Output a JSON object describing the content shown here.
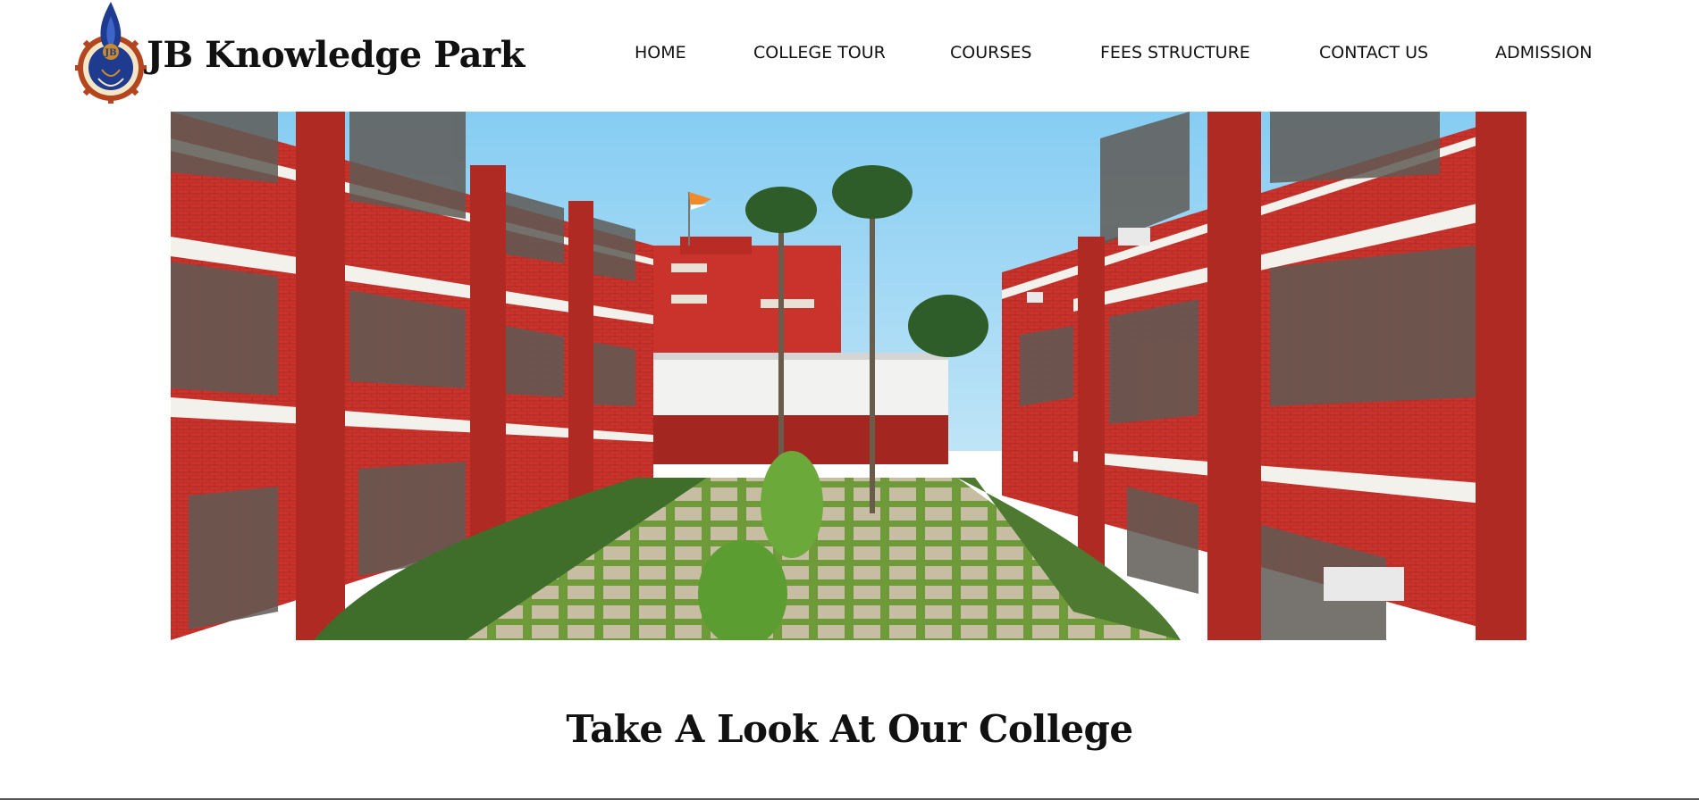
{
  "site": {
    "brand_name": "JB Knowledge Park",
    "logo_icon": "college-crest-icon"
  },
  "nav": {
    "items": [
      {
        "label": "HOME"
      },
      {
        "label": "COLLEGE TOUR"
      },
      {
        "label": "COURSES"
      },
      {
        "label": "FEES STRUCTURE"
      },
      {
        "label": "CONTACT US"
      },
      {
        "label": "ADMISSION"
      }
    ]
  },
  "hero": {
    "image_icon": "campus-courtyard-photo"
  },
  "section": {
    "title": "Take A Look At Our College"
  },
  "colors": {
    "brick": "#c9332c",
    "sky": "#8fd0f2",
    "crest_blue": "#1f3b8f",
    "crest_gold": "#c98a2b"
  }
}
